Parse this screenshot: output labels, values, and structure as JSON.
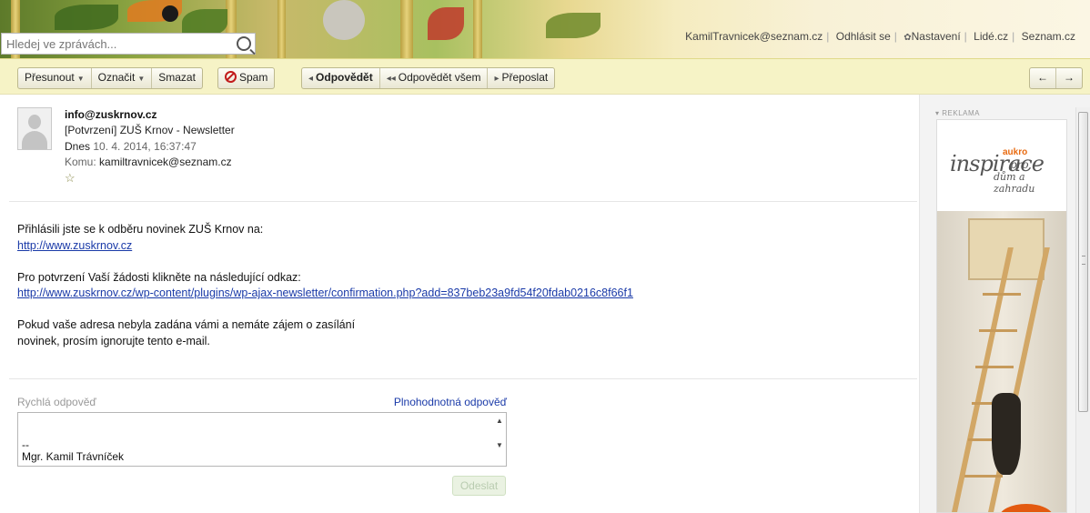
{
  "search": {
    "placeholder": "Hledej ve zprávách..."
  },
  "top_links": {
    "user": "KamilTravnicek@seznam.cz",
    "logout": "Odhlásit se",
    "settings": "Nastavení",
    "lide": "Lidé.cz",
    "seznam": "Seznam.cz"
  },
  "toolbar": {
    "move": "Přesunout",
    "mark": "Označit",
    "delete": "Smazat",
    "spam": "Spam",
    "reply": "Odpovědět",
    "reply_all": "Odpovědět všem",
    "forward": "Přeposlat",
    "prev": "←",
    "next": "→"
  },
  "email": {
    "from": "info@zuskrnov.cz",
    "subject": "[Potvrzení] ZUŠ Krnov - Newsletter",
    "date_prefix": "Dnes",
    "date": "10. 4. 2014, 16:37:47",
    "to_label": "Komu:",
    "to": "kamiltravnicek@seznam.cz",
    "star": "☆",
    "body": {
      "line1": "Přihlásili jste se k odběru novinek ZUŠ Krnov na:",
      "link1": "http://www.zuskrnov.cz",
      "line2": "Pro potvrzení Vaší žádosti klikněte na následující odkaz:",
      "link2": "http://www.zuskrnov.cz/wp-content/plugins/wp-ajax-newsletter/confirmation.php?add=837beb23a9fd54f20fdab0216c8f66f1",
      "line3a": "Pokud vaše adresa nebyla zadána vámi a nemáte zájem o zasílání",
      "line3b": "novinek, prosím ignorujte tento e-mail."
    }
  },
  "quick_reply": {
    "label": "Rychlá odpověď",
    "full_reply": "Plnohodnotná odpověď",
    "text": "\n\n--\nMgr. Kamil Trávníček",
    "send": "Odeslat"
  },
  "ad": {
    "label": "REKLAMA",
    "brand": "aukro",
    "headline": "inspirace",
    "headline_pro": "pro",
    "subline": "dům a zahradu"
  }
}
